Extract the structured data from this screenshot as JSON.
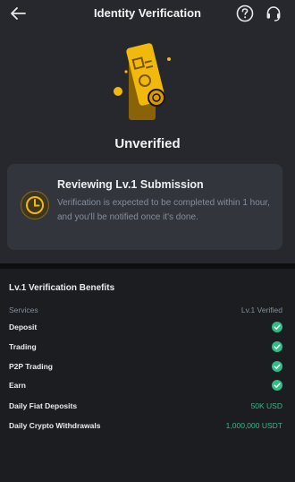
{
  "header": {
    "title": "Identity Verification",
    "back_icon": "arrow-left-icon",
    "help_icon": "question-circle-icon",
    "support_icon": "headset-icon"
  },
  "status": {
    "title": "Unverified",
    "icon": "document-stamp-icon"
  },
  "review": {
    "title": "Reviewing Lv.1 Submission",
    "description": "Verification is expected to be completed within 1 hour, and you'll be notified once it's done.",
    "icon": "clock-icon"
  },
  "benefits": {
    "title": "Lv.1 Verification Benefits",
    "col_services": "Services",
    "col_level": "Lv.1 Verified",
    "rows": [
      {
        "label": "Deposit",
        "type": "check"
      },
      {
        "label": "Trading",
        "type": "check"
      },
      {
        "label": "P2P Trading",
        "type": "check"
      },
      {
        "label": "Earn",
        "type": "check"
      },
      {
        "label": "Daily Fiat Deposits",
        "type": "text",
        "value": "50K USD"
      },
      {
        "label": "Daily Crypto Withdrawals",
        "type": "text",
        "value": "1,000,000 USDT"
      }
    ]
  },
  "colors": {
    "accent": "#f0b90b",
    "success": "#2ebd85",
    "muted": "#848e9c",
    "panel": "#26282d",
    "card": "#32353b"
  }
}
